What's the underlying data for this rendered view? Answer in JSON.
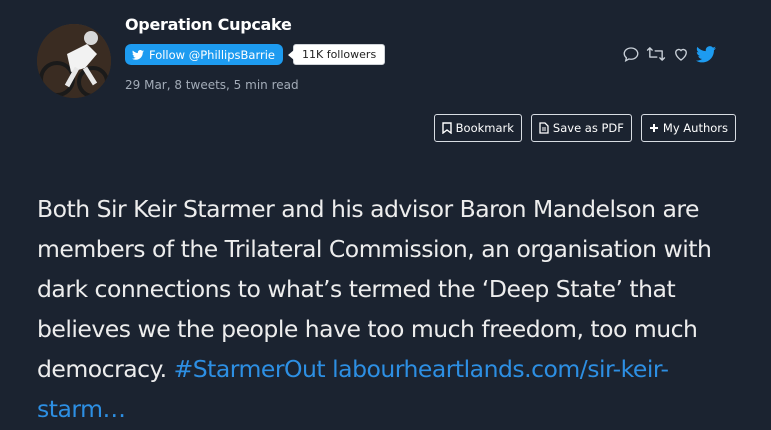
{
  "author": {
    "name": "Operation Cupcake",
    "follow_label": "Follow @PhillipsBarrie",
    "followers": "11K followers"
  },
  "meta": "29 Mar, 8 tweets, 5 min read",
  "action_icons": [
    "reply-icon",
    "retweet-icon",
    "like-icon",
    "twitter-bird-icon"
  ],
  "toolbar": {
    "bookmark": "Bookmark",
    "save_pdf": "Save as PDF",
    "my_authors": "My Authors"
  },
  "tweet": {
    "text": "Both Sir Keir Starmer and his advisor Baron Mandelson are members of the Trilateral Commission, an organisation with dark connections to what’s termed the ‘Deep State’ that believes we the people have too much freedom, too much democracy.",
    "hashtag": "#StarmerOut",
    "link": "labourheartlands.com/sir-keir-starm…"
  },
  "colors": {
    "background": "#1b2330",
    "accent": "#1d9bf0",
    "link": "#2d8fe3"
  }
}
